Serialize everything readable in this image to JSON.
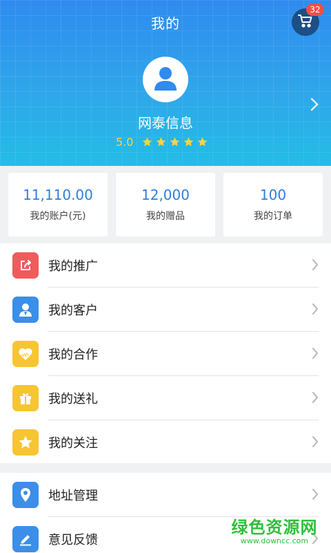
{
  "header": {
    "title": "我的",
    "cart_badge": "32",
    "company_name": "网泰信息",
    "rating_score": "5.0",
    "stars": 5,
    "star_color": "#ffd43a"
  },
  "stats": [
    {
      "value": "11,110.00",
      "label": "我的账户(元)"
    },
    {
      "value": "12,000",
      "label": "我的赠品"
    },
    {
      "value": "100",
      "label": "我的订单"
    }
  ],
  "menu_group_1": [
    {
      "label": "我的推广",
      "icon": "share-icon",
      "color": "#f05b5b"
    },
    {
      "label": "我的客户",
      "icon": "user-icon",
      "color": "#3b8fe8"
    },
    {
      "label": "我的合作",
      "icon": "handshake-heart-icon",
      "color": "#f7c531"
    },
    {
      "label": "我的送礼",
      "icon": "gift-icon",
      "color": "#f7c531"
    },
    {
      "label": "我的关注",
      "icon": "star-icon",
      "color": "#f7c531"
    }
  ],
  "menu_group_2": [
    {
      "label": "地址管理",
      "icon": "location-pin-icon",
      "color": "#3b8fe8"
    },
    {
      "label": "意见反馈",
      "icon": "edit-icon",
      "color": "#3b8fe8"
    }
  ],
  "watermark": {
    "line1": "绿色资源网",
    "line2": "www.downcc.com"
  }
}
